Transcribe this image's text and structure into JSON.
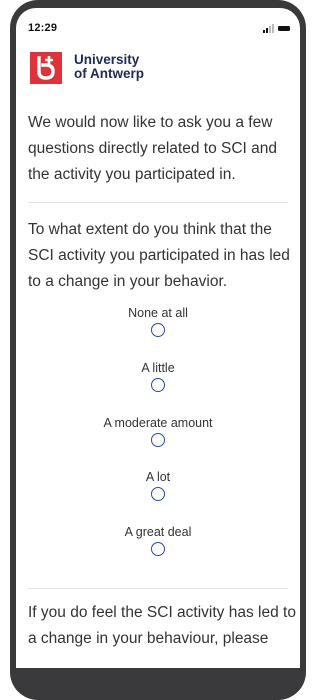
{
  "status_bar": {
    "time": "12:29"
  },
  "logo": {
    "line1": "University",
    "line2": "of Antwerp",
    "brand_color": "#e0323b",
    "text_color": "#1e2a5a"
  },
  "intro": {
    "text": "We would now like to ask you a few questions directly related to SCI and the activity you participated in."
  },
  "question": {
    "text": "To what extent do you think that the SCI activity you participated in has led to a change in your behavior."
  },
  "options": [
    {
      "label": "None at all"
    },
    {
      "label": "A little"
    },
    {
      "label": "A moderate amount"
    },
    {
      "label": "A lot"
    },
    {
      "label": "A great deal"
    }
  ],
  "followup": {
    "text": "If you do feel the SCI activity has led to a change in your behaviour, please"
  },
  "icons": [
    "signal-icon",
    "battery-icon",
    "university-logo-icon",
    "radio-icon"
  ],
  "colors": {
    "radio": "#2c4a9e",
    "text": "#333333",
    "device_frame": "#3a3a3c"
  }
}
